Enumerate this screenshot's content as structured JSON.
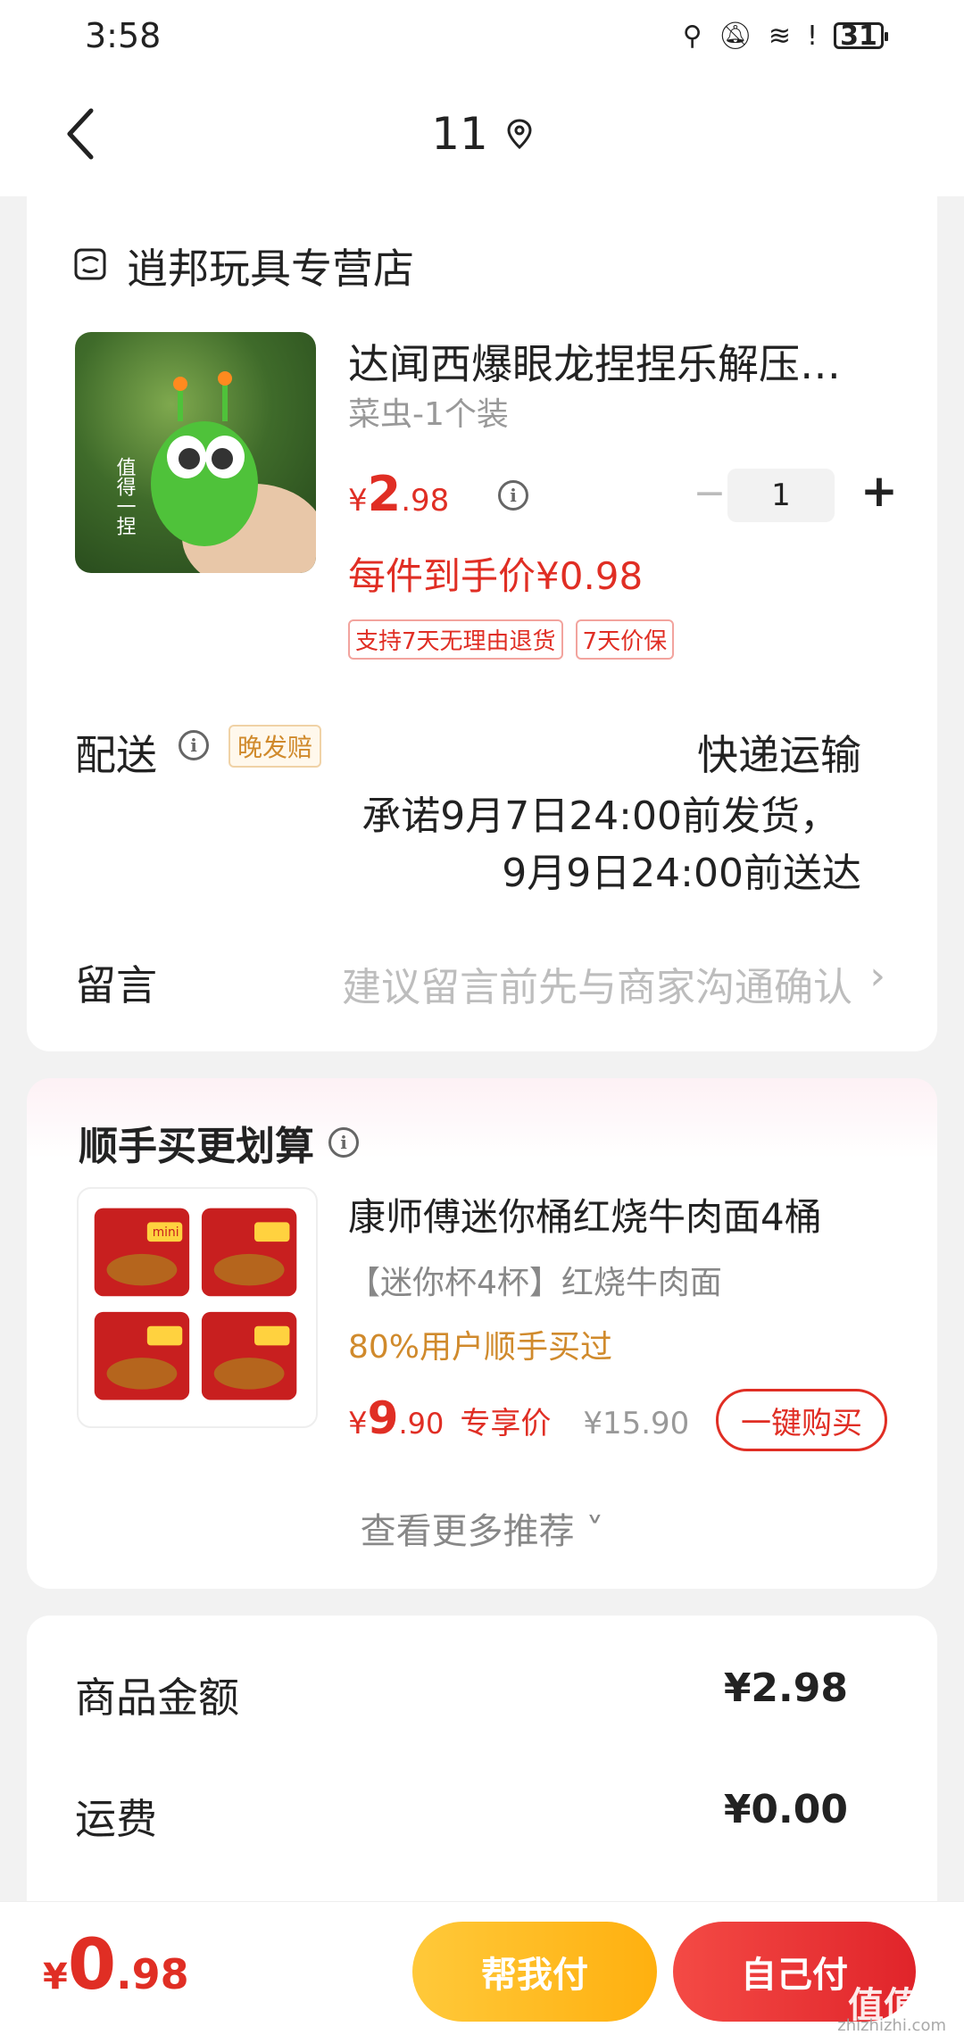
{
  "status_bar": {
    "time": "3:58",
    "icons": [
      "location-icon",
      "bell-off-icon",
      "wifi-icon",
      "alert-icon"
    ],
    "battery": "31"
  },
  "nav": {
    "title": "11"
  },
  "store": {
    "name": "逍邦玩具专营店"
  },
  "product": {
    "title": "达闻西爆眼龙捏捏乐解压…",
    "spec": "菜虫-1个装",
    "price_symbol": "¥",
    "price_int": "2",
    "price_dec": ".98",
    "quantity": "1",
    "unit_price": "每件到手价¥0.98",
    "tags": [
      "支持7天无理由退货",
      "7天价保"
    ],
    "image_text": "值得一捏"
  },
  "delivery": {
    "label": "配送",
    "badge": "晚发赔",
    "method": "快递运输",
    "promise": "承诺9月7日24:00前发货，",
    "arrive": "9月9日24:00前送达"
  },
  "message": {
    "label": "留言",
    "hint": "建议留言前先与商家沟通确认",
    "arrow": "›"
  },
  "recommend": {
    "title": "顺手买更划算",
    "name": "康师傅迷你桶红烧牛肉面4桶",
    "spec": "【迷你杯4杯】红烧牛肉面",
    "social": "80%用户顺手买过",
    "price_symbol": "¥",
    "price_int": "9",
    "price_dec": ".90",
    "price_tag": "专享价",
    "original_price": "¥15.90",
    "buy_label": "一键购买",
    "more_label": "查看更多推荐 ˅",
    "image_text": "mini"
  },
  "summary": {
    "goods_label": "商品金额",
    "goods_value": "¥2.98",
    "shipping_label": "运费",
    "shipping_value": "¥0.00"
  },
  "bottom": {
    "total_symbol": "¥",
    "total_int": "0",
    "total_dec": ".98",
    "help_pay": "帮我付",
    "self_pay": "自己付",
    "watermark": "值值值",
    "watermark_sub": "zhizhizhi.com"
  },
  "colors": {
    "accent_red": "#e02e24",
    "accent_yellow": "#ffc93a",
    "badge_orange": "#d08a2c"
  }
}
